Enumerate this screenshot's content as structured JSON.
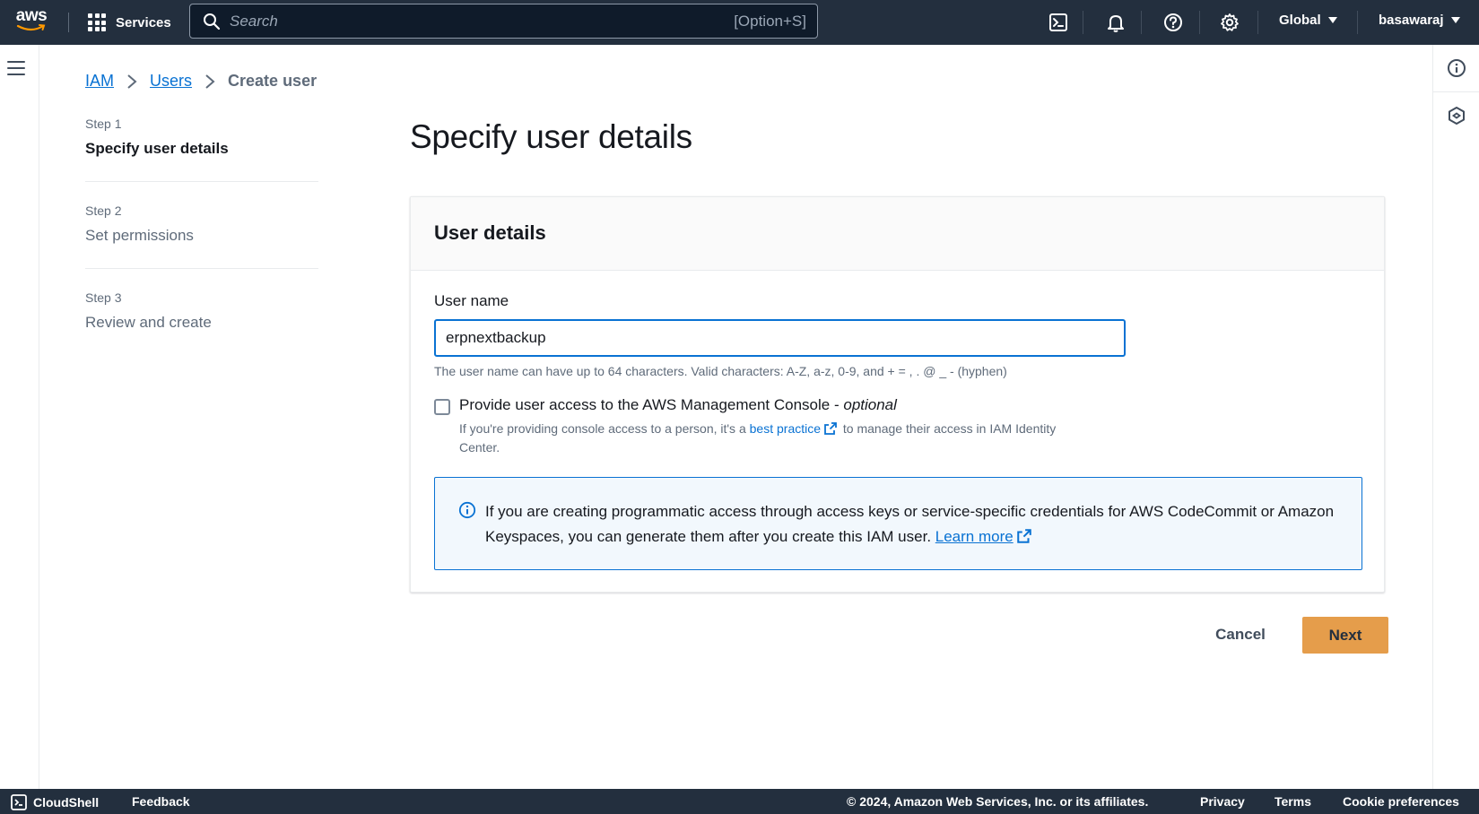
{
  "topbar": {
    "logo_text": "aws",
    "services_label": "Services",
    "search_placeholder": "Search",
    "search_shortcut": "[Option+S]",
    "region_label": "Global",
    "user_label": "basawaraj"
  },
  "breadcrumb": {
    "items": [
      "IAM",
      "Users"
    ],
    "current": "Create user"
  },
  "steps": [
    {
      "number": "Step 1",
      "title": "Specify user details",
      "active": true
    },
    {
      "number": "Step 2",
      "title": "Set permissions",
      "active": false
    },
    {
      "number": "Step 3",
      "title": "Review and create",
      "active": false
    }
  ],
  "page": {
    "title": "Specify user details"
  },
  "user_details": {
    "header": "User details",
    "username_label": "User name",
    "username_value": "erpnextbackup",
    "username_constraint": "The user name can have up to 64 characters. Valid characters: A-Z, a-z, 0-9, and + = , . @ _ - (hyphen)",
    "console_access_label": "Provide user access to the AWS Management Console - ",
    "console_access_optional": "optional",
    "console_access_desc_pre": "If you're providing console access to a person, it's a ",
    "console_access_link": "best practice",
    "console_access_desc_post": " to manage their access in IAM Identity Center.",
    "info_text": "If you are creating programmatic access through access keys or service-specific credentials for AWS CodeCommit or Amazon Keyspaces, you can generate them after you create this IAM user. ",
    "info_link": "Learn more"
  },
  "actions": {
    "cancel_label": "Cancel",
    "next_label": "Next"
  },
  "footer": {
    "cloudshell_label": "CloudShell",
    "feedback_label": "Feedback",
    "copyright": "© 2024, Amazon Web Services, Inc. or its affiliates.",
    "privacy_label": "Privacy",
    "terms_label": "Terms",
    "cookie_label": "Cookie preferences"
  },
  "colors": {
    "nav_bg": "#232f3e",
    "link": "#0972d3",
    "primary_button": "#e59d4b",
    "info_bg": "#f2f8fd"
  }
}
